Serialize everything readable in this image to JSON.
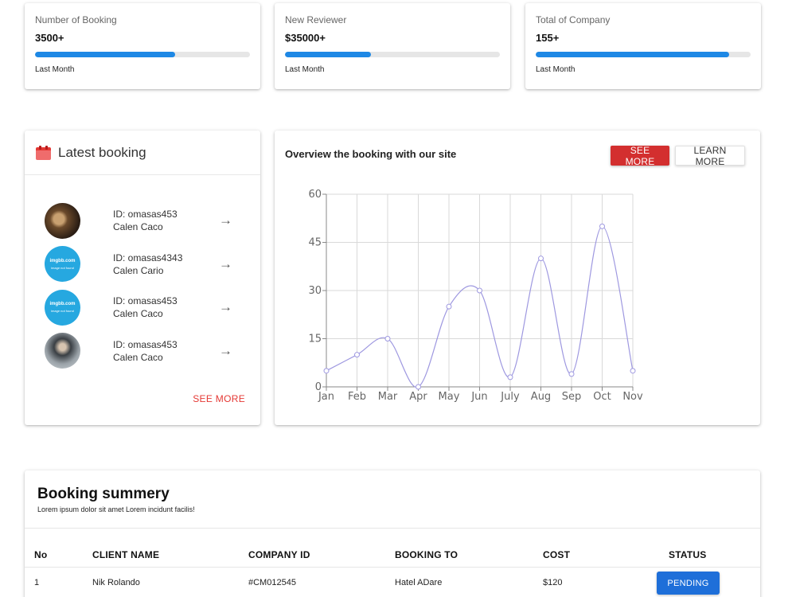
{
  "stats": [
    {
      "label": "Number of Booking",
      "value": "3500+",
      "progress": 0.65,
      "footer": "Last Month"
    },
    {
      "label": "New Reviewer",
      "value": "$35000+",
      "progress": 0.4,
      "footer": "Last Month"
    },
    {
      "label": "Total of Company",
      "value": "155+",
      "progress": 0.9,
      "footer": "Last Month"
    }
  ],
  "latest_booking": {
    "title": "Latest booking",
    "icon": "calendar-icon",
    "items": [
      {
        "id": "ID: omasas453",
        "name": "Calen Caco",
        "avatar": "photo"
      },
      {
        "id": "ID: omasas4343",
        "name": "Calen Cario",
        "avatar": "placeholder"
      },
      {
        "id": "ID: omasas453",
        "name": "Calen Caco",
        "avatar": "placeholder"
      },
      {
        "id": "ID: omasas453",
        "name": "Calen Caco",
        "avatar": "photo"
      }
    ],
    "avatar_placeholder_line1": "imgbb.com",
    "avatar_placeholder_line2": "image not found",
    "arrow": "→",
    "see_more": "SEE MORE"
  },
  "overview": {
    "title": "Overview the booking with our site",
    "see_more": "SEE MORE",
    "learn_more": "LEARN MORE"
  },
  "chart_data": {
    "type": "line",
    "categories": [
      "Jan",
      "Feb",
      "Mar",
      "Apr",
      "May",
      "Jun",
      "July",
      "Aug",
      "Sep",
      "Oct",
      "Nov"
    ],
    "series": [
      {
        "values": [
          5,
          10,
          15,
          0,
          25,
          30,
          3,
          40,
          4,
          50,
          5
        ]
      }
    ],
    "ylim": [
      0,
      60
    ],
    "yticks": [
      0,
      15,
      30,
      45,
      60
    ],
    "grid": true,
    "color": "#9e98e0"
  },
  "summary": {
    "title": "Booking summery",
    "subtitle": "Lorem ipsum dolor sit amet Lorem incidunt facilis!",
    "columns": [
      "No",
      "CLIENT NAME",
      "COMPANY ID",
      "BOOKING TO",
      "COST",
      "STATUS"
    ],
    "rows": [
      {
        "no": "1",
        "client": "Nik Rolando",
        "company_id": "#CM012545",
        "booking_to": "Hatel ADare",
        "cost": "$120",
        "status": "PENDING"
      }
    ]
  },
  "colors": {
    "accent_blue": "#1e88e5",
    "accent_red": "#d32f2f",
    "status_blue": "#1e6fd9"
  }
}
